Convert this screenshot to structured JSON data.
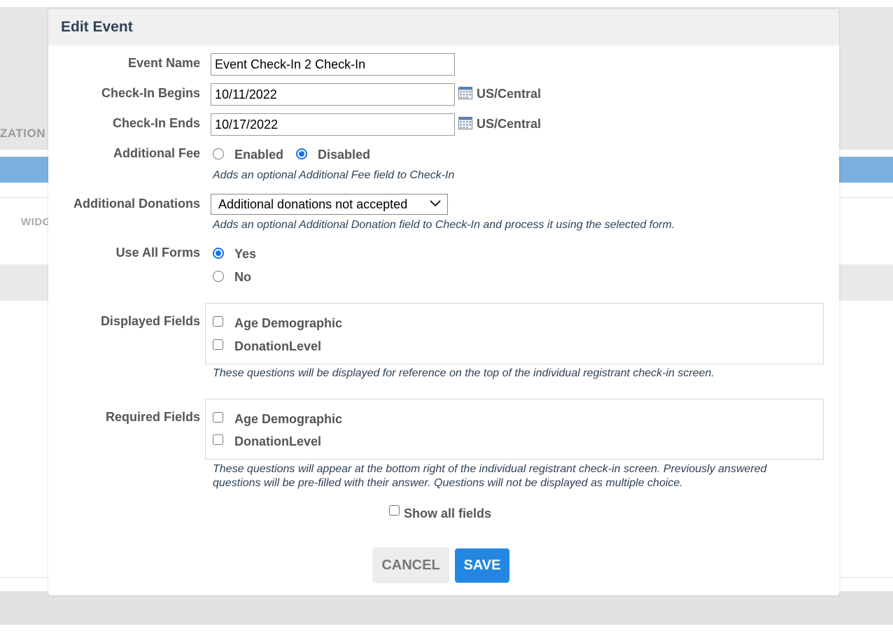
{
  "background": {
    "label_organization": "ZATION",
    "label_widget": "WIDG"
  },
  "modal": {
    "title": "Edit Event",
    "event_name": {
      "label": "Event Name",
      "value": "Event Check-In 2 Check-In"
    },
    "checkin_begins": {
      "label": "Check-In Begins",
      "value": "10/11/2022",
      "timezone": "US/Central"
    },
    "checkin_ends": {
      "label": "Check-In Ends",
      "value": "10/17/2022",
      "timezone": "US/Central"
    },
    "additional_fee": {
      "label": "Additional Fee",
      "option_enabled": "Enabled",
      "option_disabled": "Disabled",
      "selected": "Disabled",
      "help": "Adds an optional Additional Fee field to Check-In"
    },
    "additional_donations": {
      "label": "Additional Donations",
      "selected": "Additional donations not accepted",
      "help": "Adds an optional Additional Donation field to Check-In and process it using the selected form."
    },
    "use_all_forms": {
      "label": "Use All Forms",
      "option_yes": "Yes",
      "option_no": "No",
      "selected": "Yes"
    },
    "displayed_fields": {
      "label": "Displayed Fields",
      "items": [
        "Age Demographic",
        "DonationLevel"
      ],
      "help": "These questions will be displayed for reference on the top of the individual registrant check-in screen."
    },
    "required_fields": {
      "label": "Required Fields",
      "items": [
        "Age Demographic",
        "DonationLevel"
      ],
      "help_line1": "These questions will appear at the bottom right of the individual registrant check-in screen. Previously answered",
      "help_line2": "questions will be pre-filled with their answer. Questions will not be displayed as multiple choice."
    },
    "show_all_fields": "Show all fields",
    "cancel_label": "CANCEL",
    "save_label": "SAVE"
  },
  "colors": {
    "accent": "#1a73e8",
    "save_button": "#2387e2",
    "title": "#2e4257",
    "background_bar": "#7ab0de"
  }
}
